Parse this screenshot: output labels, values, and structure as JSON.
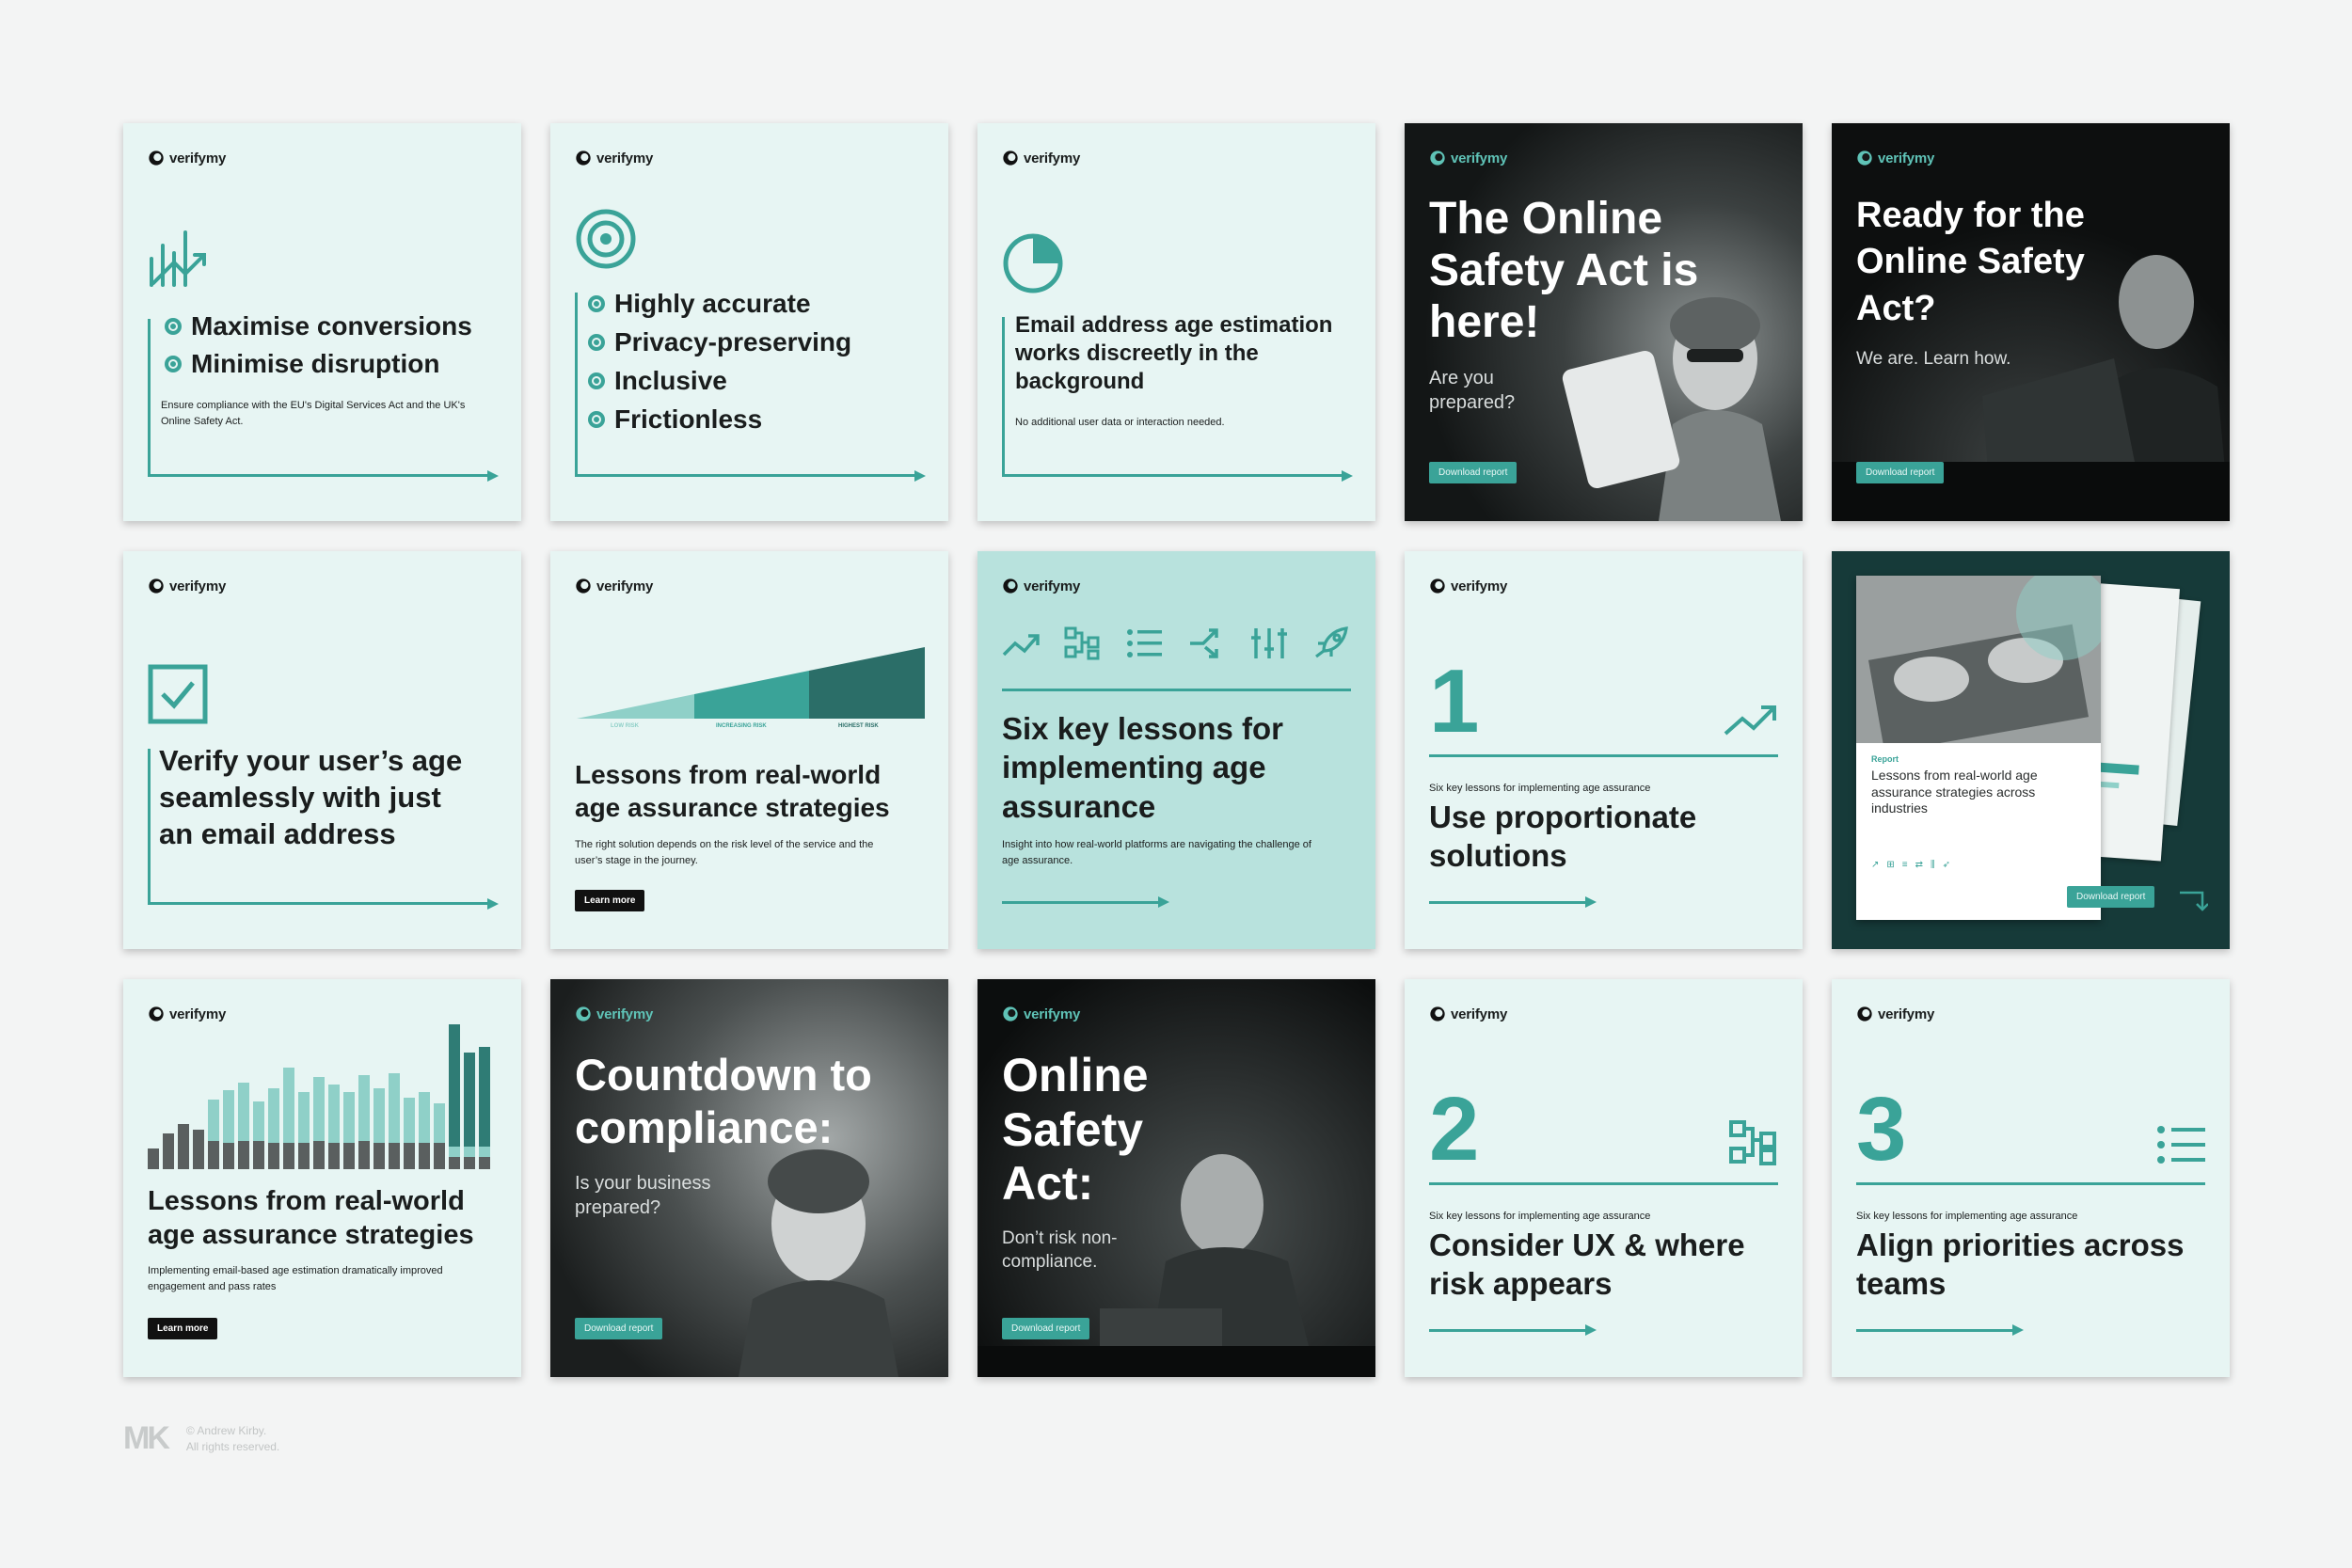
{
  "brand": "verifymy",
  "cards": {
    "c1": {
      "lines": [
        "Maximise conversions",
        "Minimise disruption"
      ],
      "note": "Ensure compliance with the EU's Digital Services Act and the UK's Online Safety Act.",
      "icon": "chart-up-icon"
    },
    "c2": {
      "lines": [
        "Highly accurate",
        "Privacy-preserving",
        "Inclusive",
        "Frictionless"
      ],
      "icon": "target-icon"
    },
    "c3": {
      "title": "Email address age estimation works discreetly in the background",
      "note": "No additional user data or interaction needed.",
      "icon": "pie-icon"
    },
    "c4": {
      "title": "The Online Safety Act is here!",
      "sub": "Are you prepared?",
      "button": "Download report"
    },
    "c5": {
      "title": "Ready for the Online Safety Act?",
      "sub": "We are. Learn how.",
      "button": "Download report"
    },
    "c6": {
      "title": "Verify your user’s age seamlessly with just an email address",
      "icon": "checkbox-icon"
    },
    "c7": {
      "title": "Lessons from real-world age assurance strategies",
      "note": "The right solution depends on the risk level of the service and the user’s stage in the journey.",
      "button": "Learn more",
      "risk_labels": [
        "LOW RISK",
        "INCREASING RISK",
        "HIGHEST RISK"
      ]
    },
    "c8": {
      "title": "Six key lessons for implementing age assurance",
      "note": "Insight into how real-world platforms are navigating the challenge of age assurance."
    },
    "c9": {
      "number": "1",
      "kicker": "Six key lessons for implementing age assurance",
      "title": "Use proportionate solutions"
    },
    "c10": {
      "report_label": "Report",
      "title": "Lessons from real-world age assurance strategies across industries",
      "button": "Download report"
    },
    "c11": {
      "title": "Lessons from real-world age assurance strategies",
      "note": "Implementing email-based age estimation dramatically improved engagement and pass rates",
      "button": "Learn more"
    },
    "c12": {
      "title": "Countdown to compliance:",
      "sub": "Is your business prepared?",
      "button": "Download report"
    },
    "c13": {
      "title": "Online Safety Act:",
      "sub": "Don’t risk non-compliance.",
      "button": "Download report"
    },
    "c14": {
      "number": "2",
      "kicker": "Six key lessons for implementing age assurance",
      "title": "Consider UX & where risk appears"
    },
    "c15": {
      "number": "3",
      "kicker": "Six key lessons for implementing age assurance",
      "title": "Align priorities across teams"
    }
  },
  "footer": {
    "logo": "MK",
    "copyright_line1": "© Andrew Kirby.",
    "copyright_line2": "All rights reserved."
  },
  "colors": {
    "teal": "#3aa398",
    "mint": "#e7f5f3",
    "mint_mid": "#b8e2dd",
    "dark": "#151818",
    "deep_teal": "#163a39"
  }
}
